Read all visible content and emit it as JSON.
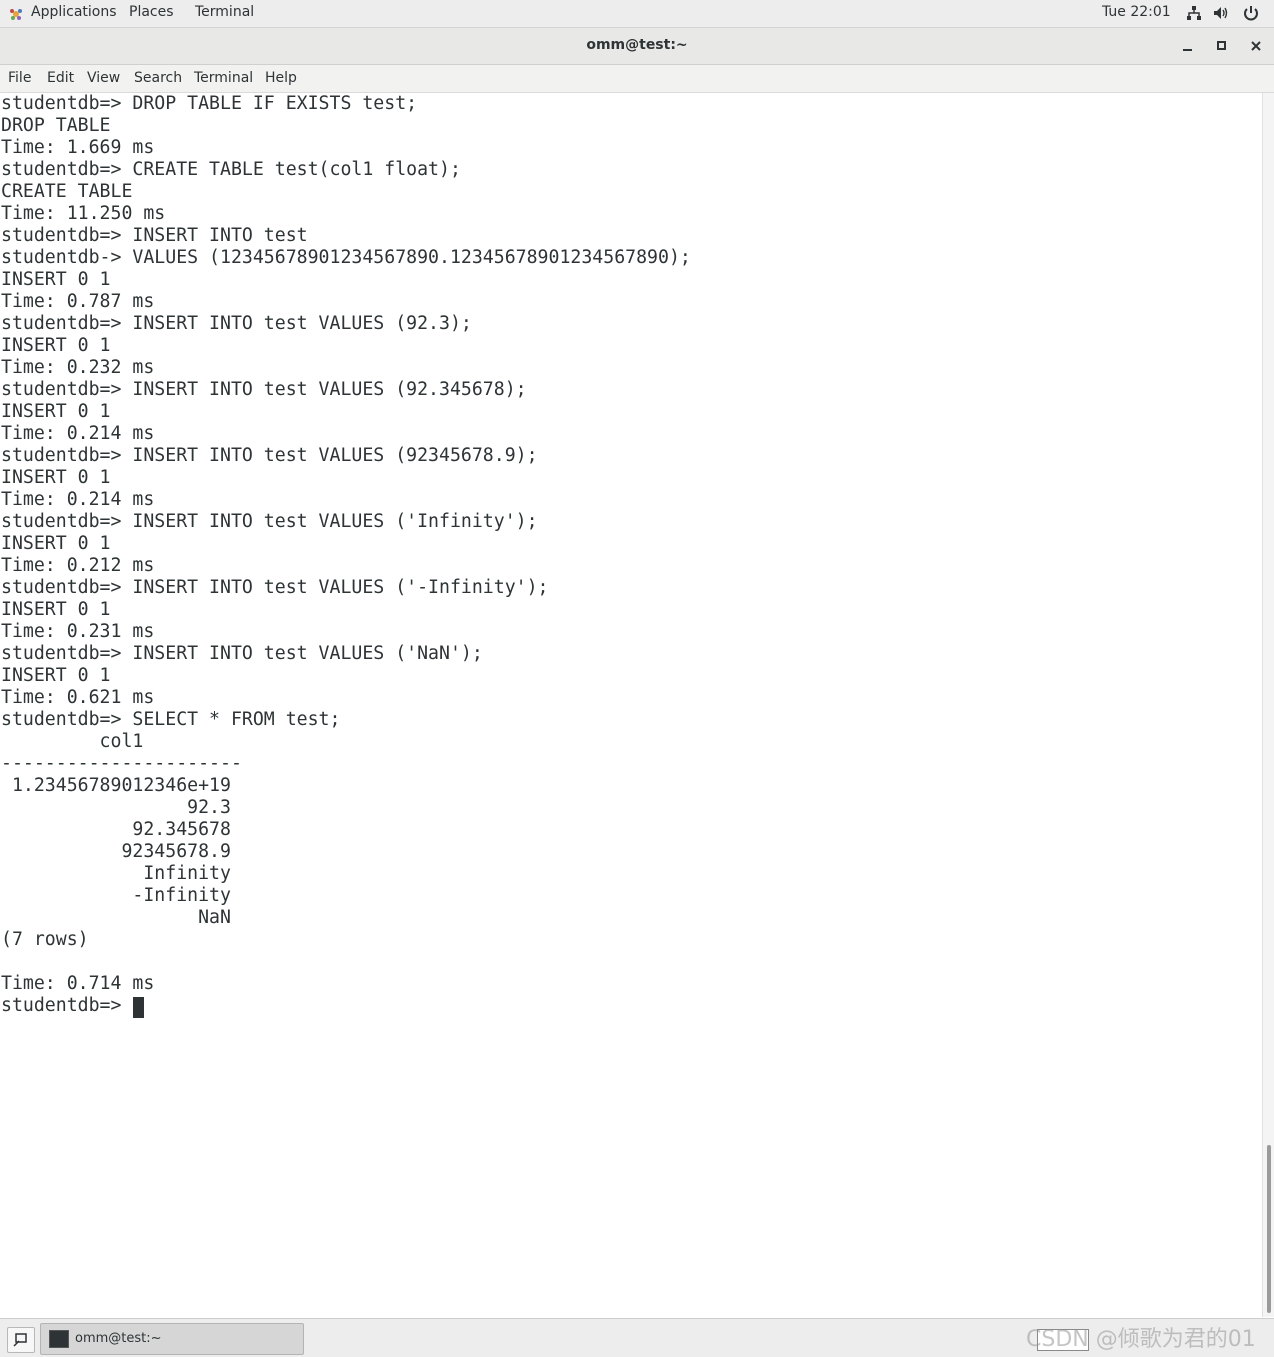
{
  "topbar": {
    "applications": "Applications",
    "places": "Places",
    "terminal": "Terminal",
    "clock": "Tue 22:01",
    "icons": [
      "network-icon",
      "volume-icon",
      "power-icon"
    ]
  },
  "window": {
    "title": "omm@test:~"
  },
  "menubar": {
    "items": [
      "File",
      "Edit",
      "View",
      "Search",
      "Terminal",
      "Help"
    ]
  },
  "terminal": {
    "lines": [
      "studentdb=> DROP TABLE IF EXISTS test;",
      "DROP TABLE",
      "Time: 1.669 ms",
      "studentdb=> CREATE TABLE test(col1 float);",
      "CREATE TABLE",
      "Time: 11.250 ms",
      "studentdb=> INSERT INTO test",
      "studentdb-> VALUES (12345678901234567890.12345678901234567890);",
      "INSERT 0 1",
      "Time: 0.787 ms",
      "studentdb=> INSERT INTO test VALUES (92.3);",
      "INSERT 0 1",
      "Time: 0.232 ms",
      "studentdb=> INSERT INTO test VALUES (92.345678);",
      "INSERT 0 1",
      "Time: 0.214 ms",
      "studentdb=> INSERT INTO test VALUES (92345678.9);",
      "INSERT 0 1",
      "Time: 0.214 ms",
      "studentdb=> INSERT INTO test VALUES ('Infinity');",
      "INSERT 0 1",
      "Time: 0.212 ms",
      "studentdb=> INSERT INTO test VALUES ('-Infinity');",
      "INSERT 0 1",
      "Time: 0.231 ms",
      "studentdb=> INSERT INTO test VALUES ('NaN');",
      "INSERT 0 1",
      "Time: 0.621 ms",
      "studentdb=> SELECT * FROM test;",
      "         col1",
      "----------------------",
      " 1.23456789012346e+19",
      "                 92.3",
      "            92.345678",
      "           92345678.9",
      "             Infinity",
      "            -Infinity",
      "                  NaN",
      "(7 rows)",
      "",
      "Time: 0.714 ms",
      "studentdb=> "
    ]
  },
  "taskbar": {
    "task_label": "omm@test:~"
  },
  "watermark": "CSDN @倾歌为君的01"
}
